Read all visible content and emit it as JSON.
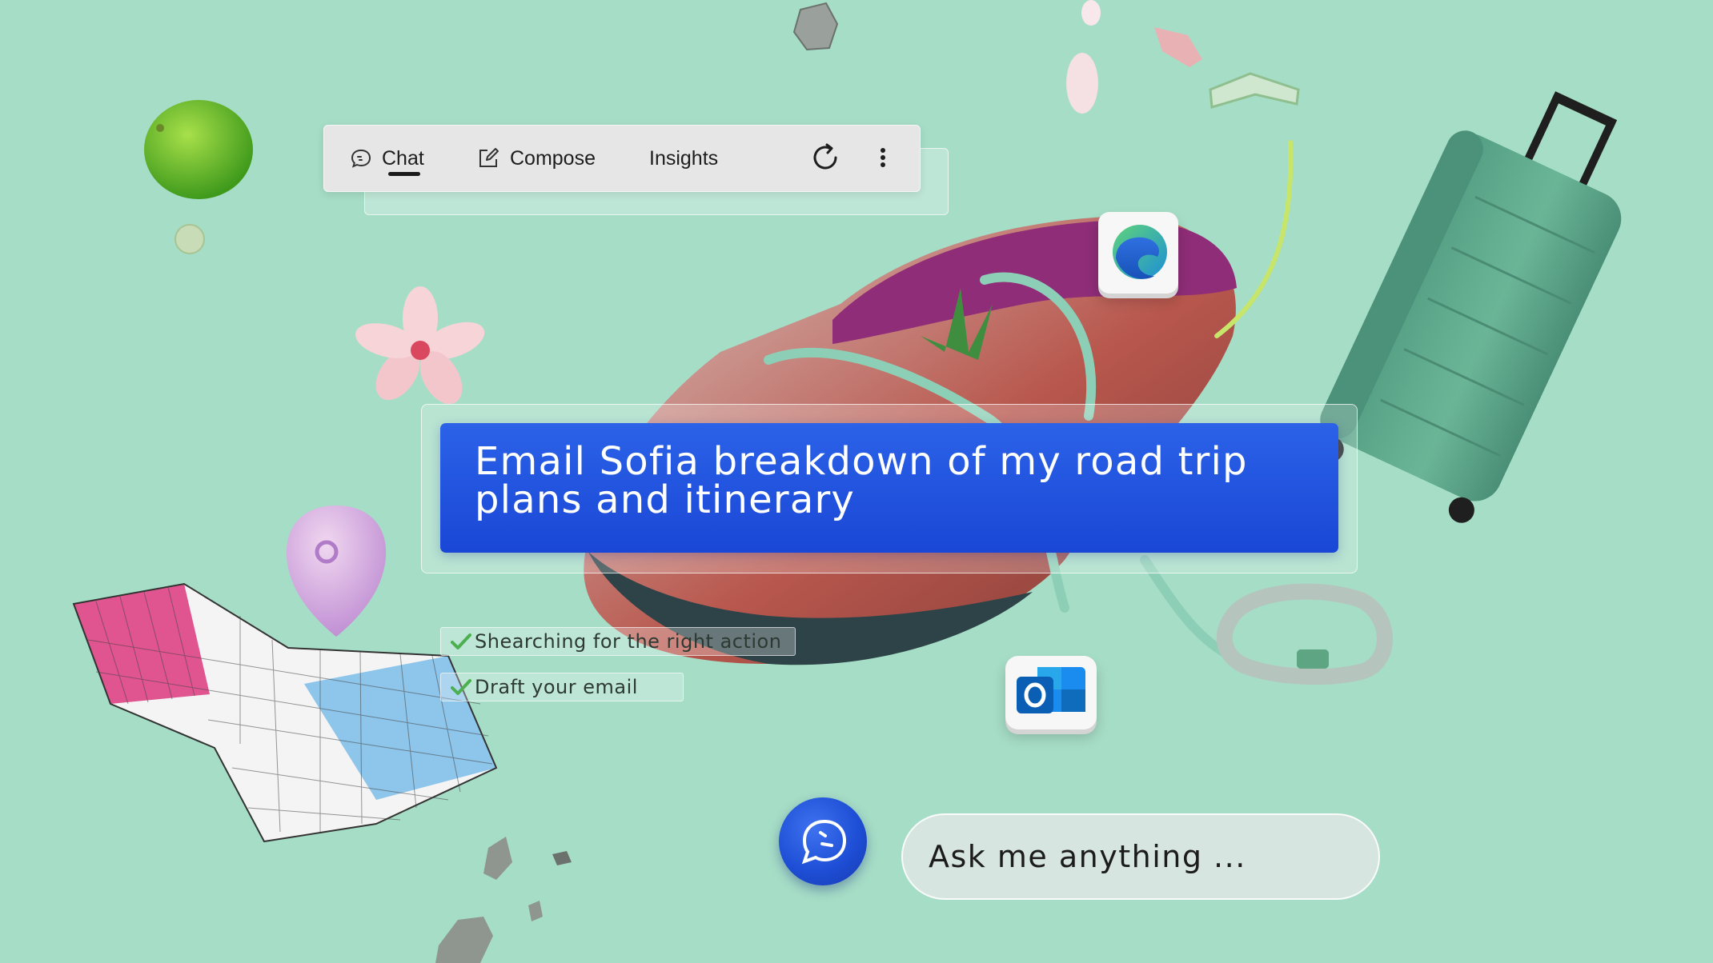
{
  "toolbar": {
    "tabs": [
      {
        "label": "Chat",
        "icon": "chat-bubble-icon",
        "active": true
      },
      {
        "label": "Compose",
        "icon": "compose-pencil-icon",
        "active": false
      },
      {
        "label": "Insights",
        "active": false
      }
    ],
    "refresh_icon": "refresh-icon",
    "more_icon": "more-vertical-icon"
  },
  "prompt": {
    "line1": "Email Sofia breakdown of my road trip",
    "line2": "plans and itinerary"
  },
  "steps": [
    {
      "label": "Shearching for the right action",
      "status": "done"
    },
    {
      "label": "Draft your email",
      "status": "done"
    }
  ],
  "ask": {
    "placeholder": "Ask me anything ...",
    "button_icon": "chat-bubble-icon"
  },
  "apps": [
    {
      "name": "Microsoft Edge",
      "icon": "edge-icon"
    },
    {
      "name": "Outlook",
      "icon": "outlook-icon"
    }
  ],
  "colors": {
    "background": "#a6ddc6",
    "prompt_blue": "#1a47d6",
    "check_green": "#4caf50",
    "suitcase": "#5aa58a"
  }
}
